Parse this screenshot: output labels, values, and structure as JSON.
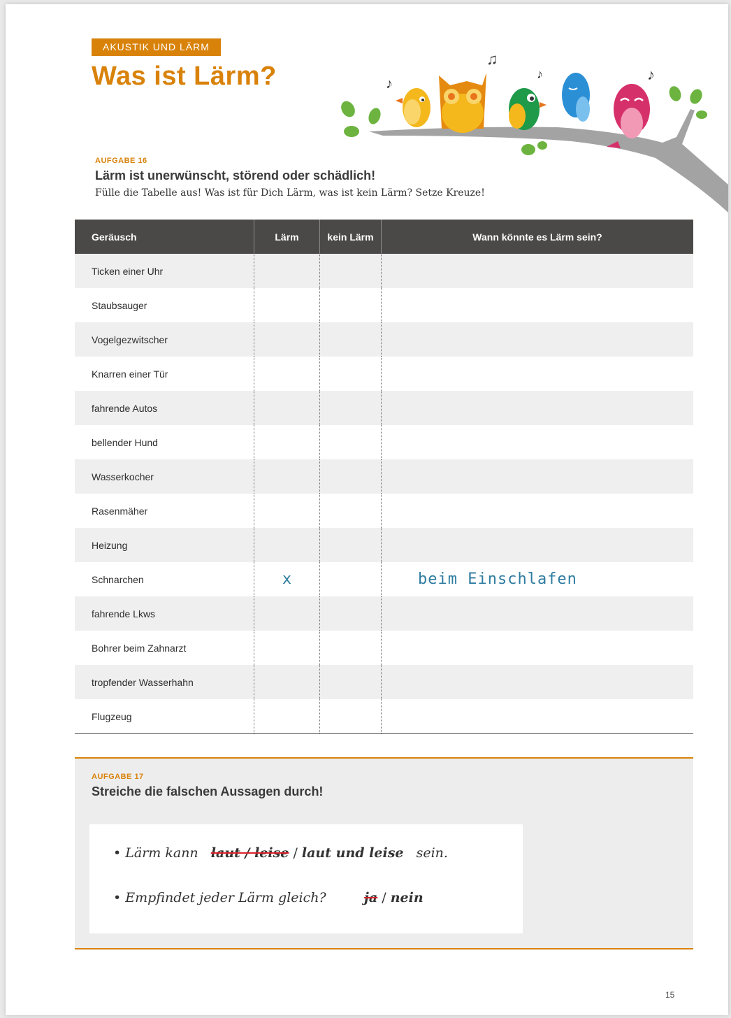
{
  "header": {
    "section_label": "AKUSTIK UND LÄRM",
    "title": "Was ist Lärm?"
  },
  "task16": {
    "label": "AUFGABE 16",
    "heading": "Lärm ist unerwünscht, störend oder schädlich!",
    "instruction": "Fülle die Tabelle aus! Was ist für Dich Lärm, was ist kein Lärm? Setze Kreuze!",
    "columns": [
      "Geräusch",
      "Lärm",
      "kein Lärm",
      "Wann könnte es Lärm sein?"
    ],
    "rows": [
      {
        "sound": "Ticken einer Uhr",
        "laerm": "",
        "kein_laerm": "",
        "wann": ""
      },
      {
        "sound": "Staubsauger",
        "laerm": "",
        "kein_laerm": "",
        "wann": ""
      },
      {
        "sound": "Vogelgezwitscher",
        "laerm": "",
        "kein_laerm": "",
        "wann": ""
      },
      {
        "sound": "Knarren einer Tür",
        "laerm": "",
        "kein_laerm": "",
        "wann": ""
      },
      {
        "sound": "fahrende Autos",
        "laerm": "",
        "kein_laerm": "",
        "wann": ""
      },
      {
        "sound": "bellender Hund",
        "laerm": "",
        "kein_laerm": "",
        "wann": ""
      },
      {
        "sound": "Wasserkocher",
        "laerm": "",
        "kein_laerm": "",
        "wann": ""
      },
      {
        "sound": "Rasenmäher",
        "laerm": "",
        "kein_laerm": "",
        "wann": ""
      },
      {
        "sound": "Heizung",
        "laerm": "",
        "kein_laerm": "",
        "wann": ""
      },
      {
        "sound": "Schnarchen",
        "laerm": "x",
        "kein_laerm": "",
        "wann": "beim Einschlafen"
      },
      {
        "sound": "fahrende Lkws",
        "laerm": "",
        "kein_laerm": "",
        "wann": ""
      },
      {
        "sound": "Bohrer beim Zahnarzt",
        "laerm": "",
        "kein_laerm": "",
        "wann": ""
      },
      {
        "sound": "tropfender Wasserhahn",
        "laerm": "",
        "kein_laerm": "",
        "wann": ""
      },
      {
        "sound": "Flugzeug",
        "laerm": "",
        "kein_laerm": "",
        "wann": ""
      }
    ]
  },
  "task17": {
    "label": "AUFGABE 17",
    "heading": "Streiche die falschen Aussagen durch!",
    "statement1": {
      "bullet": "•",
      "prefix": "Lärm kann",
      "struck": "laut / leise",
      "separator": "/",
      "answer": "laut und leise",
      "suffix": "sein."
    },
    "statement2": {
      "bullet": "•",
      "prefix": "Empfindet jeder Lärm gleich?",
      "struck": "ja",
      "separator": "/",
      "answer": "nein"
    }
  },
  "footer": {
    "page_number": "15"
  },
  "colors": {
    "accent": "#d9820a",
    "table_header": "#4a4947",
    "handwriting": "#2e7ca0",
    "strike": "#d8222a"
  }
}
